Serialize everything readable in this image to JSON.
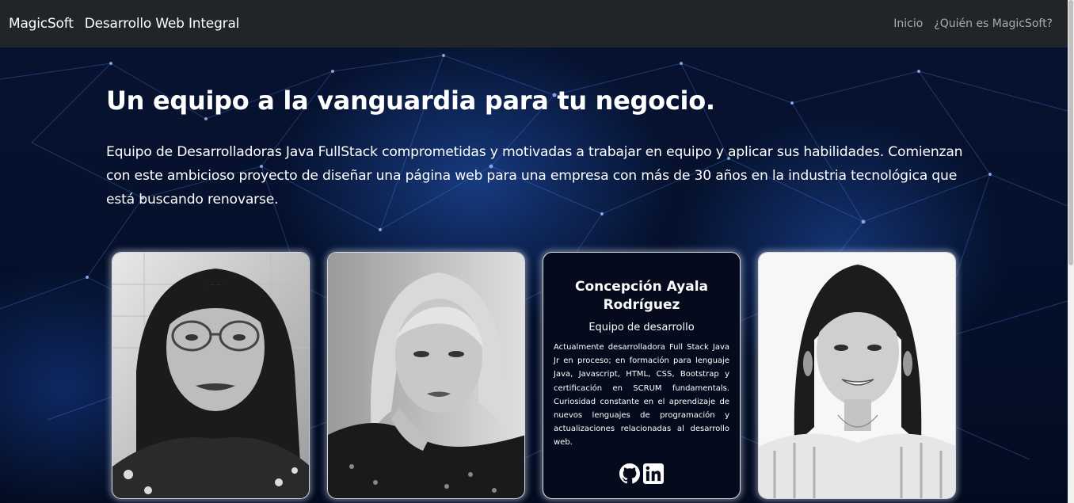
{
  "navbar": {
    "brand": "MagicSoft",
    "subtitle": "Desarrollo Web Integral",
    "links": [
      {
        "label": "Inicio"
      },
      {
        "label": "¿Quién es MagicSoft?"
      }
    ]
  },
  "hero": {
    "title": "Un equipo a la vanguardia para tu negocio.",
    "text": "Equipo de Desarrolladoras Java FullStack comprometidas y motivadas a trabajar en equipo y aplicar sus habilidades. Comienzan con este ambicioso proyecto de diseñar una página web para una empresa con más de 30 años en la industria tecnológica que está buscando renovarse."
  },
  "cards": [
    {
      "type": "photo",
      "alt": "portrait-1"
    },
    {
      "type": "photo",
      "alt": "portrait-2"
    },
    {
      "type": "info",
      "name": "Concepción Ayala Rodríguez",
      "role": "Equipo de desarrollo",
      "description": "Actualmente desarrolladora Full Stack Java Jr en proceso; en formación para lenguaje Java, Javascript, HTML, CSS, Bootstrap y certificación en SCRUM fundamentals. Curiosidad constante en el aprendizaje de nuevos lenguajes de programación y actualizaciones relacionadas al desarrollo web.",
      "icons": [
        "github-icon",
        "linkedin-icon"
      ]
    },
    {
      "type": "photo",
      "alt": "portrait-4"
    }
  ],
  "colors": {
    "navbar_bg": "#212529",
    "nav_link": "#a8abaf",
    "hero_bg": "#061230",
    "accent": "#2a5fc8"
  }
}
